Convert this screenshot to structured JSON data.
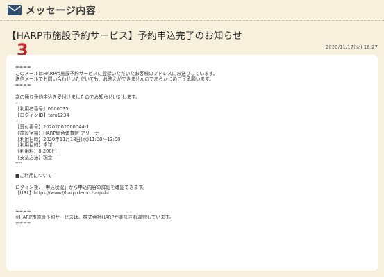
{
  "header": {
    "title": "メッセージ内容",
    "icon": "mail-icon"
  },
  "message": {
    "subject": "【HARP市施設予約サービス】予約申込完了のお知らせ",
    "badge": "3",
    "date": "2020/11/17(火) 16:27",
    "body_lines": [
      "====",
      "このメールはHARP市施設予約サービスに登録いただいたお客様のアドレスにお送りしています。",
      "送信メールでお問い合わせいただいても、お答えができませんのであらかじめご了承願います。",
      "====",
      "",
      "次の通り予約申込を受付けましたのでお知らせいたします。",
      "----",
      "【利用者番号】0000035",
      "【ログインID】taro1234",
      "----",
      "【受付番号】20202002000044-1",
      "【施設室場】HARP総合体育館 アリーナ",
      "【利用日時】2020年11月18日(水)11:00～13:00",
      "【利用目的】卓球",
      "【利用料】8,200円",
      "【支払方法】現金",
      "----",
      "",
      "■ご利用について",
      "",
      "ログイン後、「申込状況」から申込内容の詳細を確認できます。",
      "【URL】https://www//harp.demo.harpshi",
      "",
      "",
      "====",
      "※HARP市施設予約サービスは、株式会社HARPが委託され運営しています。",
      "===="
    ]
  },
  "colors": {
    "page_background": "#f6f0dd",
    "body_background": "#ffffff",
    "badge": "#c0272d",
    "icon": "#2f4f72"
  }
}
